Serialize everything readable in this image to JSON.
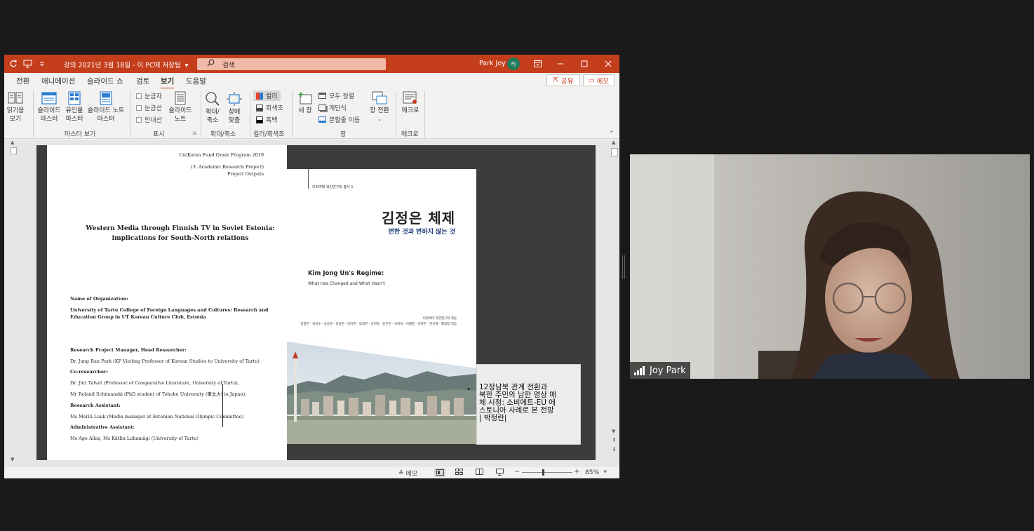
{
  "titlebar": {
    "doc_title": "강의 2021년 3월 18일 - 이 PC에 저장됨",
    "search_placeholder": "검색",
    "user_name": "Park Joy",
    "user_initials": "PJ"
  },
  "menu": {
    "tabs": [
      "전환",
      "애니메이션",
      "슬라이드 쇼",
      "검토",
      "보기",
      "도움말"
    ],
    "active": "보기",
    "share_label": "공유",
    "memo_label": "메모"
  },
  "ribbon": {
    "reading_view": "읽기용\n보기",
    "master_buttons": [
      "슬라이드\n마스터",
      "유인물\n마스터",
      "슬라이드 노트\n마스터"
    ],
    "group_master": "마스터 보기",
    "show_checks": [
      "눈금자",
      "눈금선",
      "안내선"
    ],
    "notes_button": "슬라이드\n노트",
    "group_show": "표시",
    "zoom_button": "확대/\n축소",
    "fit_button": "창에\n맞춤",
    "group_zoom": "확대/축소",
    "color_options": [
      "컬러",
      "회색조",
      "흑백"
    ],
    "group_color": "컬러/회색조",
    "new_window": "새 창",
    "window_small": [
      "모두 정렬",
      "계단식",
      "분할줄 이동"
    ],
    "switch_window": "창 전환",
    "group_window": "창",
    "macro_button": "매크로",
    "group_macro": "매크로"
  },
  "document": {
    "header_lines": [
      "UniKorea Fund Grant Program 2019",
      "(3. Academic Research Project)",
      "Project Outputs"
    ],
    "title_line1": "Western Media through Finnish TV in Soviet Estonia:",
    "title_line2": "implications for South-North relations",
    "org_label": "Name of Organization:",
    "org_value": "University of Tartu College of Foreign Languages and Cultures: Research and Education Group in UT Korean Culture Club, Estonia",
    "manager_label": "Research Project Manager, Head Researcher:",
    "manager_value": "Dr. Jung Ran Park (KF Visiting Professor of Korean Studies to University of Tartu)",
    "co_label": "Co-researcher:",
    "co_value1": "Dr. Jüri Talvet (Professor of Comparative Literature, University of Tartu),",
    "co_value2": "Mr Roland Schimanski (PhD student of Tohoku University (東北大) in Japan),",
    "ra_label": "Research Assistant:",
    "ra_value": "Ms Merili Luuk (Media manager at Estonian National Olympic Committee)",
    "admin_label": "Administrative Assistant:",
    "admin_value": "Ms Age Allas, Ms Kätlin Luhamägi (University of Tartu)"
  },
  "book": {
    "series": "이화여대 북한연구회 총서 1",
    "kor_title": "김정은 체제",
    "kor_subtitle": "변한 것과 변하지 않는 것",
    "en_title": "Kim Jong Un's Regime:",
    "en_subtitle": "What Has Changed and What Hasn't",
    "publisher": "이화여대 북한연구회 엮음",
    "authors": "김병연 · 김성수 · 오승영 · 박정란 · 박지연 · 박희진 · 유현정 · 윤은주 · 이미숙 · 이혜정 · 조영주 · 한인애 · 황의정 지음"
  },
  "note": {
    "text": "12장남북 관계 전환과 북한 주민의 남한 영상 매체 시청: 소비에트-EU 에스토니아 사례로 본 전망 | 박정란|"
  },
  "status": {
    "notes_label": "메모",
    "zoom_percent": "85%"
  },
  "video": {
    "participant_name": "Joy Park"
  },
  "colors": {
    "ppt_accent": "#c43e1c",
    "ribbon_bg": "#f3f2f1",
    "book_blue": "#1d3a78"
  }
}
